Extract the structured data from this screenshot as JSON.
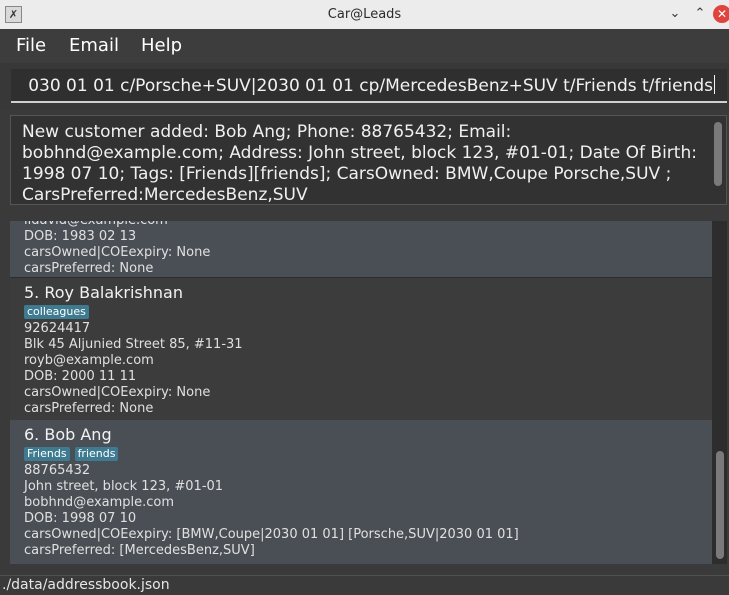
{
  "window": {
    "title": "Car@Leads",
    "icon": "x-app-icon",
    "minimize_glyph": "⌄",
    "maximize_glyph": "⌃",
    "close_glyph": "✕"
  },
  "menu": {
    "file": "File",
    "email": "Email",
    "help": "Help"
  },
  "command": {
    "value": "030 01 01 c/Porsche+SUV|2030 01 01 cp/MercedesBenz+SUV t/Friends t/friends"
  },
  "result": {
    "text": "New customer added: Bob Ang; Phone: 88765432; Email: bobhnd@example.com; Address: John street, block 123, #01-01; Date Of Birth: 1998 07 10; Tags: [Friends][friends]; CarsOwned: BMW,Coupe Porsche,SUV ; CarsPreferred:MercedesBenz,SUV"
  },
  "persons": [
    {
      "email": "lidavid@example.com",
      "dob": "DOB: 1983 02 13",
      "cars_owned": "carsOwned|COEexpiry: None",
      "cars_preferred": "carsPreferred: None"
    },
    {
      "index_name": "5.  Roy Balakrishnan",
      "tags": [
        "colleagues"
      ],
      "phone": "92624417",
      "address": "Blk 45 Aljunied Street 85, #11-31",
      "email": "royb@example.com",
      "dob": "DOB: 2000 11 11",
      "cars_owned": "carsOwned|COEexpiry: None",
      "cars_preferred": "carsPreferred: None"
    },
    {
      "index_name": "6.  Bob Ang",
      "tags": [
        "Friends",
        "friends"
      ],
      "phone": "88765432",
      "address": "John street, block 123, #01-01",
      "email": "bobhnd@example.com",
      "dob": "DOB: 1998 07 10",
      "cars_owned": "carsOwned|COEexpiry: [BMW,Coupe|2030 01 01] [Porsche,SUV|2030 01 01]",
      "cars_preferred": "carsPreferred: [MercedesBenz,SUV]"
    }
  ],
  "status": {
    "path": "./data/addressbook.json"
  }
}
